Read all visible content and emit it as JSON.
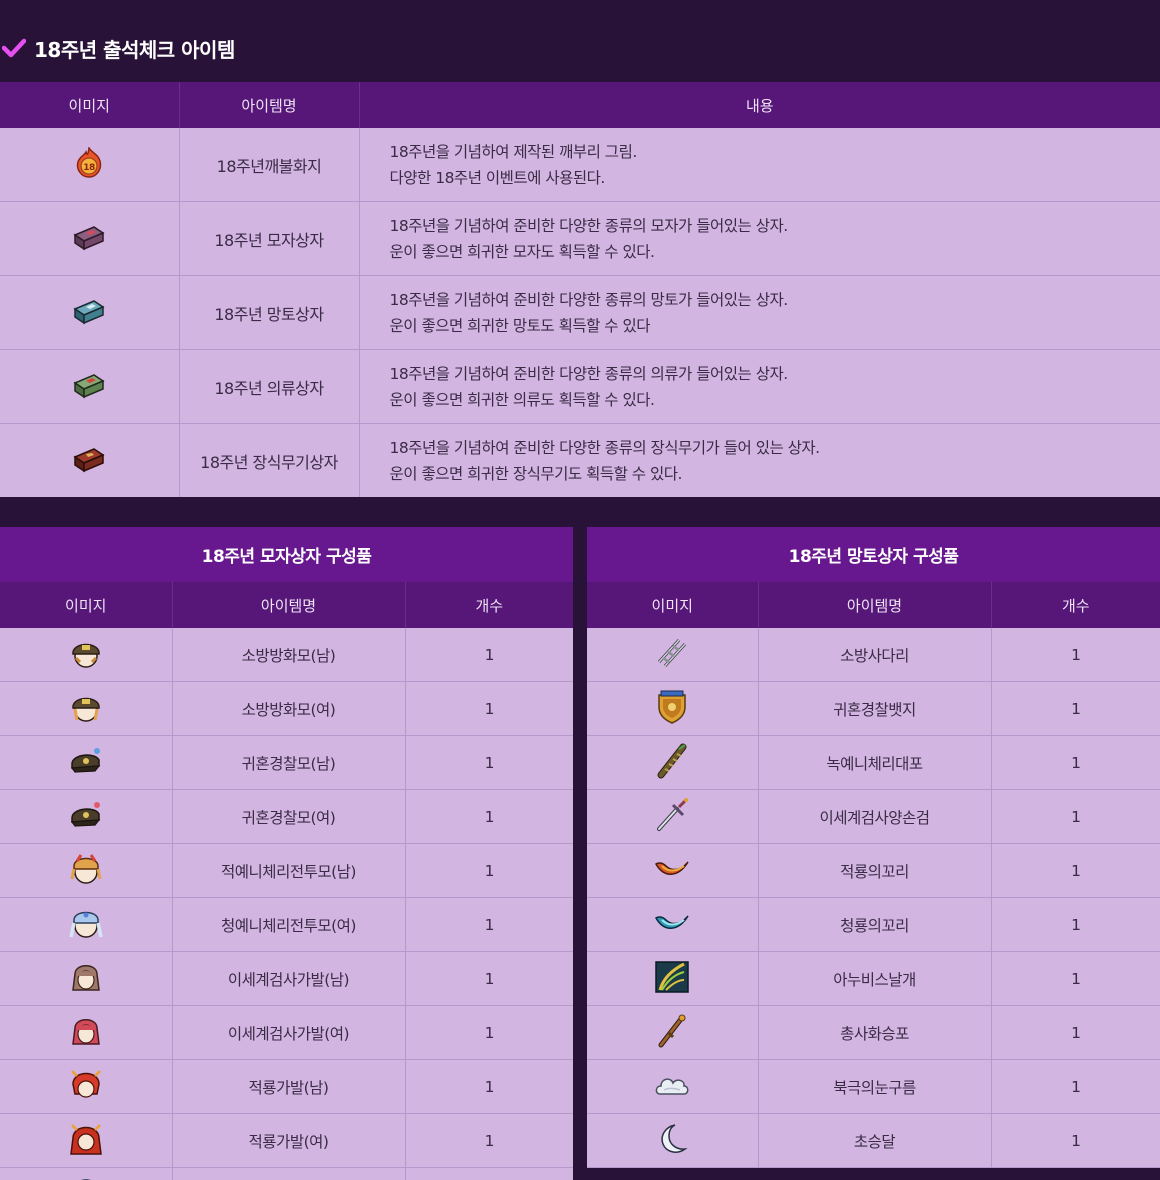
{
  "section": {
    "title": "18주년 출석체크 아이템",
    "check_icon": "checkmark-icon",
    "accent": "#e64ff0"
  },
  "main_table": {
    "headers": {
      "image": "이미지",
      "name": "아이템명",
      "content": "내용"
    },
    "rows": [
      {
        "icon": "fire-coin-18-icon",
        "name": "18주년깨불화지",
        "line1": "18주년을 기념하여 제작된 깨부리 그림.",
        "line2": "다양한 18주년 이벤트에 사용된다."
      },
      {
        "icon": "hat-box-icon",
        "name": "18주년 모자상자",
        "line1": "18주년을 기념하여 준비한 다양한 종류의 모자가 들어있는 상자.",
        "line2": "운이 좋으면 희귀한 모자도 획득할 수 있다."
      },
      {
        "icon": "cape-box-icon",
        "name": "18주년 망토상자",
        "line1": "18주년을 기념하여 준비한 다양한 종류의 망토가 들어있는 상자.",
        "line2": "운이 좋으면 희귀한 망토도 획득할 수 있다"
      },
      {
        "icon": "clothes-box-icon",
        "name": "18주년 의류상자",
        "line1": "18주년을 기념하여 준비한 다양한 종류의 의류가 들어있는 상자.",
        "line2": "운이 좋으면 희귀한 의류도 획득할 수 있다."
      },
      {
        "icon": "weapon-box-icon",
        "name": "18주년 장식무기상자",
        "line1": "18주년을 기념하여 준비한 다양한 종류의 장식무기가 들어 있는 상자.",
        "line2": "운이 좋으면 희귀한 장식무기도 획득할 수 있다."
      }
    ]
  },
  "hat_box": {
    "title": "18주년 모자상자 구성품",
    "headers": {
      "image": "이미지",
      "name": "아이템명",
      "count": "개수"
    },
    "rows": [
      {
        "icon": "firefighter-hat-male-icon",
        "name": "소방방화모(남)",
        "count": "1"
      },
      {
        "icon": "firefighter-hat-female-icon",
        "name": "소방방화모(여)",
        "count": "1"
      },
      {
        "icon": "police-cap-male-icon",
        "name": "귀혼경찰모(남)",
        "count": "1"
      },
      {
        "icon": "police-cap-female-icon",
        "name": "귀혼경찰모(여)",
        "count": "1"
      },
      {
        "icon": "red-battle-helmet-icon",
        "name": "적예니체리전투모(남)",
        "count": "1"
      },
      {
        "icon": "blue-battle-helmet-icon",
        "name": "청예니체리전투모(여)",
        "count": "1"
      },
      {
        "icon": "swordsman-wig-male-icon",
        "name": "이세계검사가발(남)",
        "count": "1"
      },
      {
        "icon": "swordsman-wig-female-icon",
        "name": "이세계검사가발(여)",
        "count": "1"
      },
      {
        "icon": "red-dragon-wig-male-icon",
        "name": "적룡가발(남)",
        "count": "1"
      },
      {
        "icon": "red-dragon-wig-female-icon",
        "name": "적룡가발(여)",
        "count": "1"
      },
      {
        "icon": "hat-icon",
        "name": "",
        "count": ""
      }
    ]
  },
  "cape_box": {
    "title": "18주년 망토상자 구성품",
    "headers": {
      "image": "이미지",
      "name": "아이템명",
      "count": "개수"
    },
    "rows": [
      {
        "icon": "ladder-icon",
        "name": "소방사다리",
        "count": "1"
      },
      {
        "icon": "police-badge-icon",
        "name": "귀혼경찰뱃지",
        "count": "1"
      },
      {
        "icon": "cape-scroll-icon",
        "name": "녹예니체리대포",
        "count": "1"
      },
      {
        "icon": "sword-icon",
        "name": "이세계검사양손검",
        "count": "1"
      },
      {
        "icon": "red-dragon-tail-icon",
        "name": "적룡의꼬리",
        "count": "1"
      },
      {
        "icon": "blue-dragon-tail-icon",
        "name": "청룡의꼬리",
        "count": "1"
      },
      {
        "icon": "anubis-wing-icon",
        "name": "아누비스날개",
        "count": "1"
      },
      {
        "icon": "gun-icon",
        "name": "총사화승포",
        "count": "1"
      },
      {
        "icon": "snow-cloud-icon",
        "name": "북극의눈구름",
        "count": "1"
      },
      {
        "icon": "crescent-moon-icon",
        "name": "초승달",
        "count": "1"
      }
    ]
  }
}
